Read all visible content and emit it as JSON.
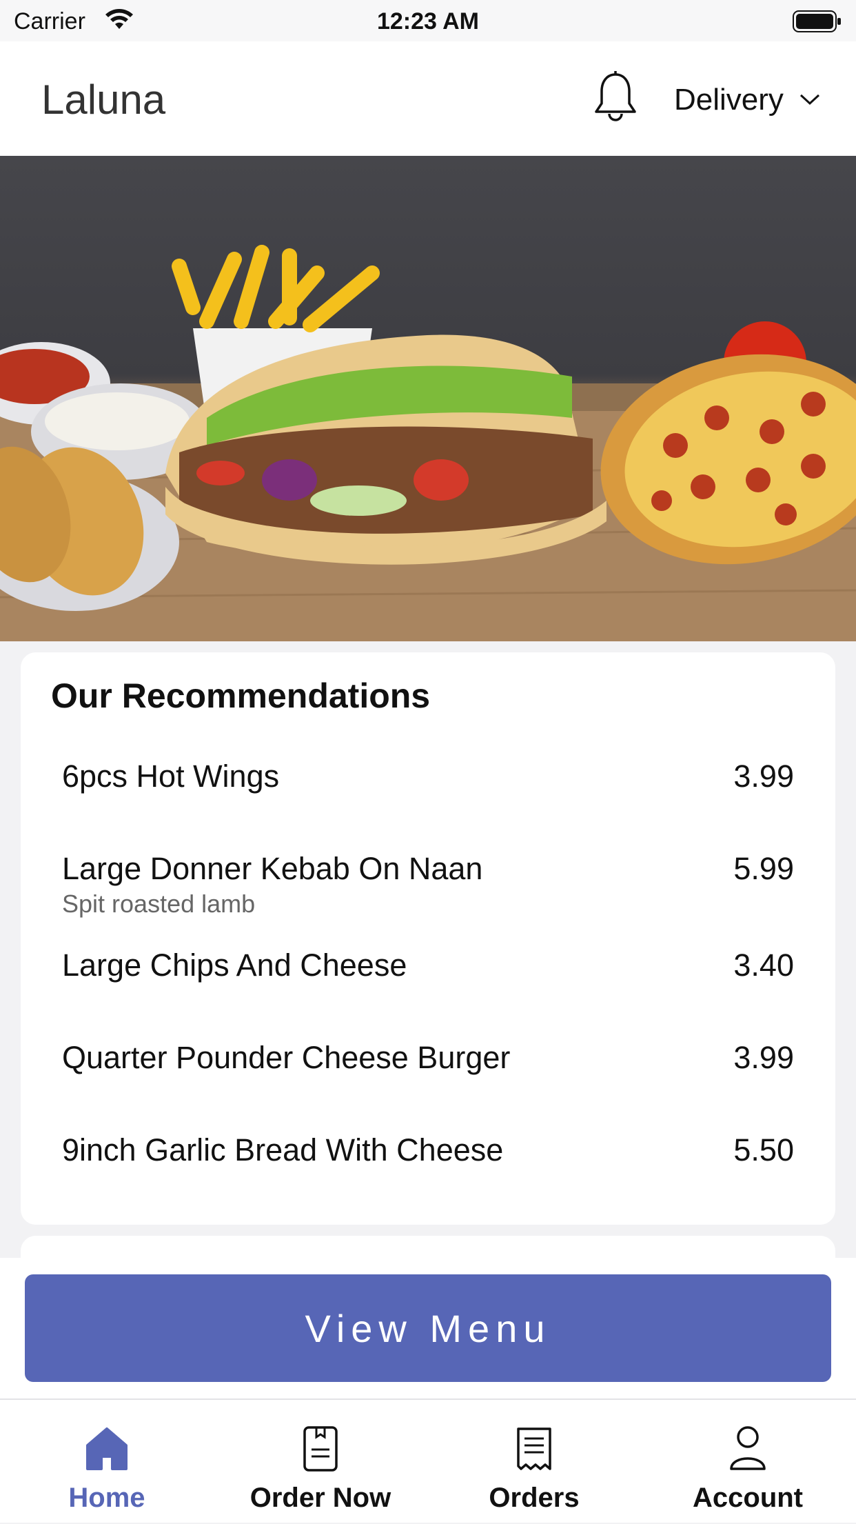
{
  "status_bar": {
    "carrier": "Carrier",
    "time": "12:23 AM"
  },
  "header": {
    "title": "Laluna",
    "order_mode": "Delivery",
    "icons": [
      "bell-icon",
      "chevron-down-icon"
    ]
  },
  "recommendations": {
    "heading": "Our Recommendations",
    "items": [
      {
        "name": "6pcs Hot Wings",
        "description": "",
        "price": "3.99"
      },
      {
        "name": "Large Donner Kebab On Naan",
        "description": "Spit roasted lamb",
        "price": "5.99"
      },
      {
        "name": "Large Chips And Cheese",
        "description": "",
        "price": "3.40"
      },
      {
        "name": "Quarter Pounder Cheese Burger",
        "description": "",
        "price": "3.99"
      },
      {
        "name": "9inch Garlic Bread With Cheese",
        "description": "",
        "price": "5.50"
      }
    ]
  },
  "cta": {
    "label": "View Menu"
  },
  "tabbar": {
    "tabs": [
      {
        "label": "Home",
        "icon": "home-icon",
        "active": true
      },
      {
        "label": "Order Now",
        "icon": "menu-book-icon",
        "active": false
      },
      {
        "label": "Orders",
        "icon": "receipt-icon",
        "active": false
      },
      {
        "label": "Account",
        "icon": "person-icon",
        "active": false
      }
    ]
  },
  "colors": {
    "accent": "#5766b6",
    "background": "#f2f2f4"
  }
}
